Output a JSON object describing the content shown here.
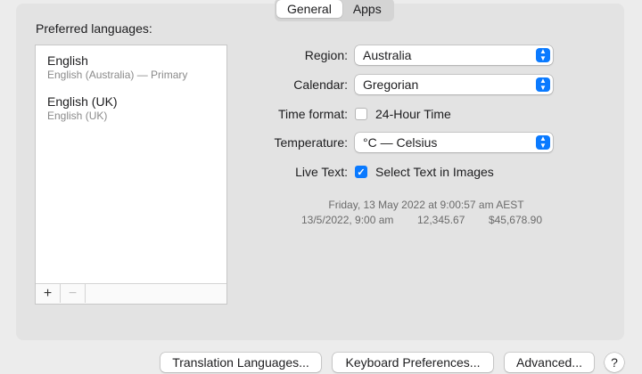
{
  "tabs": [
    {
      "label": "General",
      "active": true
    },
    {
      "label": "Apps",
      "active": false
    }
  ],
  "languages": {
    "title": "Preferred languages:",
    "items": [
      {
        "name": "English",
        "detail": "English (Australia) — Primary"
      },
      {
        "name": "English (UK)",
        "detail": "English (UK)"
      }
    ],
    "add_label": "+",
    "remove_label": "−"
  },
  "settings": {
    "region": {
      "label": "Region:",
      "value": "Australia"
    },
    "calendar": {
      "label": "Calendar:",
      "value": "Gregorian"
    },
    "time_format": {
      "label": "Time format:",
      "checkbox_label": "24-Hour Time",
      "checked": false
    },
    "temperature": {
      "label": "Temperature:",
      "value": "°C — Celsius"
    },
    "live_text": {
      "label": "Live Text:",
      "checkbox_label": "Select Text in Images",
      "checked": true
    }
  },
  "preview": {
    "long_date": "Friday, 13 May 2022 at 9:00:57 am AEST",
    "short_date": "13/5/2022, 9:00 am",
    "number": "12,345.67",
    "currency": "$45,678.90"
  },
  "buttons": {
    "translation": "Translation Languages...",
    "keyboard": "Keyboard Preferences...",
    "advanced": "Advanced...",
    "help": "?"
  },
  "colors": {
    "accent": "#0a7aff"
  }
}
